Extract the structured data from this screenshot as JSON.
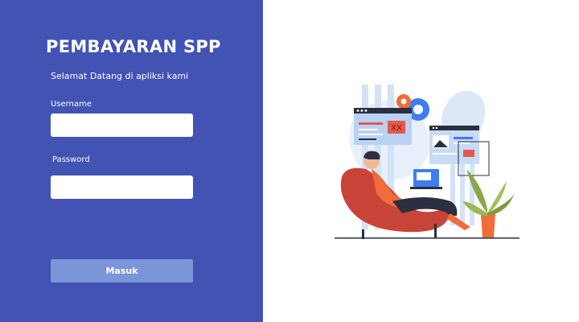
{
  "app": {
    "title": "PEMBAYARAN SPP",
    "welcome": "Selamat Datang di apliksi kami"
  },
  "form": {
    "username_label": "Username",
    "username_value": "",
    "password_label": "Password",
    "password_value": "",
    "submit_label": "Masuk"
  },
  "illustration": {
    "icon": "person-with-laptop-illustration",
    "window_text": "XX"
  },
  "colors": {
    "panel": "#4253b4",
    "button": "#7a95d8",
    "accent_orange": "#f26b3a",
    "accent_blue": "#3f7df0",
    "chair_red": "#c94438"
  }
}
